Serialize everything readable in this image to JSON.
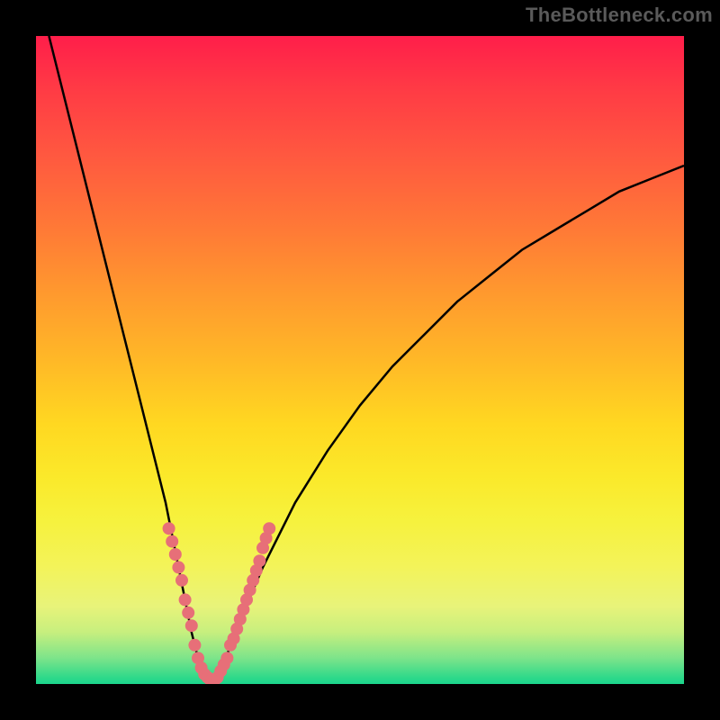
{
  "watermark": "TheBottleneck.com",
  "chart_data": {
    "type": "line",
    "title": "",
    "xlabel": "",
    "ylabel": "",
    "xlim": [
      0,
      100
    ],
    "ylim": [
      0,
      100
    ],
    "grid": false,
    "legend": false,
    "series": [
      {
        "name": "bottleneck-curve",
        "x": [
          2,
          4,
          6,
          8,
          10,
          12,
          14,
          16,
          18,
          20,
          21,
          22,
          23,
          24,
          25,
          26,
          27,
          28,
          29,
          30,
          32,
          35,
          40,
          45,
          50,
          55,
          60,
          65,
          70,
          75,
          80,
          85,
          90,
          95,
          100
        ],
        "y": [
          100,
          92,
          84,
          76,
          68,
          60,
          52,
          44,
          36,
          28,
          23,
          18,
          13,
          8,
          4,
          1,
          0,
          1,
          3,
          6,
          11,
          18,
          28,
          36,
          43,
          49,
          54,
          59,
          63,
          67,
          70,
          73,
          76,
          78,
          80
        ]
      }
    ],
    "markers": {
      "name": "sample-points",
      "color": "#e76f78",
      "points": [
        {
          "x": 20.5,
          "y": 24
        },
        {
          "x": 21.0,
          "y": 22
        },
        {
          "x": 21.5,
          "y": 20
        },
        {
          "x": 22.0,
          "y": 18
        },
        {
          "x": 22.5,
          "y": 16
        },
        {
          "x": 23.0,
          "y": 13
        },
        {
          "x": 23.5,
          "y": 11
        },
        {
          "x": 24.0,
          "y": 9
        },
        {
          "x": 24.5,
          "y": 6
        },
        {
          "x": 25.0,
          "y": 4
        },
        {
          "x": 25.5,
          "y": 2.5
        },
        {
          "x": 26.0,
          "y": 1.5
        },
        {
          "x": 26.5,
          "y": 1
        },
        {
          "x": 27.0,
          "y": 0.5
        },
        {
          "x": 27.5,
          "y": 0.5
        },
        {
          "x": 28.0,
          "y": 1
        },
        {
          "x": 28.5,
          "y": 2
        },
        {
          "x": 29.0,
          "y": 3
        },
        {
          "x": 29.5,
          "y": 4
        },
        {
          "x": 30.0,
          "y": 6
        },
        {
          "x": 30.5,
          "y": 7
        },
        {
          "x": 31.0,
          "y": 8.5
        },
        {
          "x": 31.5,
          "y": 10
        },
        {
          "x": 32.0,
          "y": 11.5
        },
        {
          "x": 32.5,
          "y": 13
        },
        {
          "x": 33.0,
          "y": 14.5
        },
        {
          "x": 33.5,
          "y": 16
        },
        {
          "x": 34.0,
          "y": 17.5
        },
        {
          "x": 34.5,
          "y": 19
        },
        {
          "x": 35.0,
          "y": 21
        },
        {
          "x": 35.5,
          "y": 22.5
        },
        {
          "x": 36.0,
          "y": 24
        }
      ]
    },
    "colors": {
      "gradient_top": "#ff1e4a",
      "gradient_mid": "#ffd821",
      "gradient_bottom": "#1ad58c",
      "curve": "#000000",
      "marker": "#e76f78",
      "frame": "#000000"
    }
  }
}
